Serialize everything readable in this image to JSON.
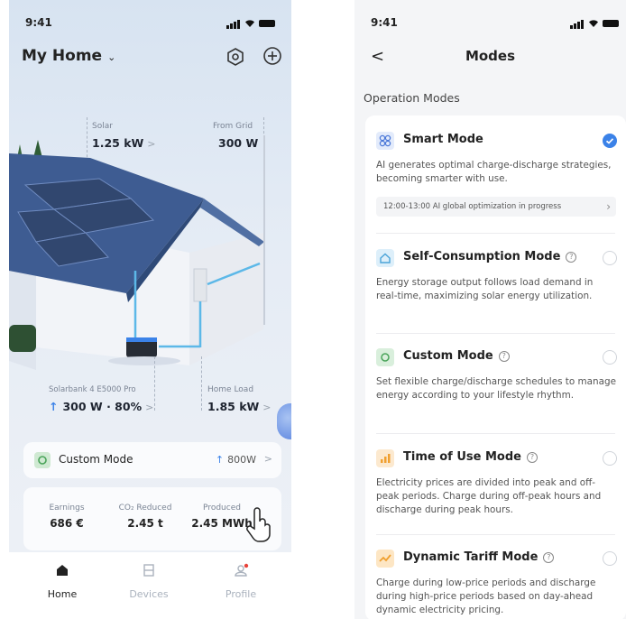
{
  "left": {
    "status_time": "9:41",
    "home_title": "My Home",
    "solar": {
      "label": "Solar",
      "value": "1.25 kW",
      "arrow": ">"
    },
    "grid": {
      "label": "From Grid",
      "value": "300 W"
    },
    "battery": {
      "label": "Solarbank 4 E5000 Pro",
      "value": "300 W · 80%",
      "arrow": ">"
    },
    "home_load": {
      "label": "Home Load",
      "value": "1.85 kW",
      "arrow": ">"
    },
    "mode_card": {
      "label": "Custom Mode",
      "power": "800W",
      "arrow": ">"
    },
    "stats": [
      {
        "label": "Earnings",
        "value": "686 €"
      },
      {
        "label": "CO₂ Reduced",
        "value": "2.45 t"
      },
      {
        "label": "Produced",
        "value": "2.45 MWh"
      }
    ],
    "tabs": [
      {
        "label": "Home",
        "icon": "home-icon"
      },
      {
        "label": "Devices",
        "icon": "devices-icon"
      },
      {
        "label": "Profile",
        "icon": "profile-icon"
      }
    ],
    "colors": {
      "accent": "#3b82e8",
      "roof": "#3e5c92",
      "wall": "#f4f6f9"
    }
  },
  "right": {
    "status_time": "9:41",
    "back": "<",
    "title": "Modes",
    "section": "Operation Modes",
    "modes": [
      {
        "name": "Smart Mode",
        "desc": "AI generates optimal charge-discharge strategies, becoming smarter with use.",
        "progress": "12:00-13:00  AI global optimization in progress",
        "selected": true,
        "icon": "smart-mode-icon"
      },
      {
        "name": "Self-Consumption Mode",
        "desc": "Energy storage output follows load demand in real-time, maximizing solar energy utilization.",
        "selected": false,
        "icon": "self-consumption-icon"
      },
      {
        "name": "Custom Mode",
        "desc": "Set flexible charge/discharge schedules to manage energy according to your lifestyle rhythm.",
        "selected": false,
        "icon": "custom-mode-icon"
      },
      {
        "name": "Time of Use Mode",
        "desc": "Electricity prices are divided into peak and off-peak periods. Charge during off-peak hours and discharge during peak hours.",
        "selected": false,
        "icon": "time-of-use-icon"
      },
      {
        "name": "Dynamic Tariff Mode",
        "desc": "Charge during low-price periods and discharge during high-price periods based on day-ahead dynamic electricity pricing.",
        "selected": false,
        "icon": "dynamic-tariff-icon"
      }
    ]
  }
}
